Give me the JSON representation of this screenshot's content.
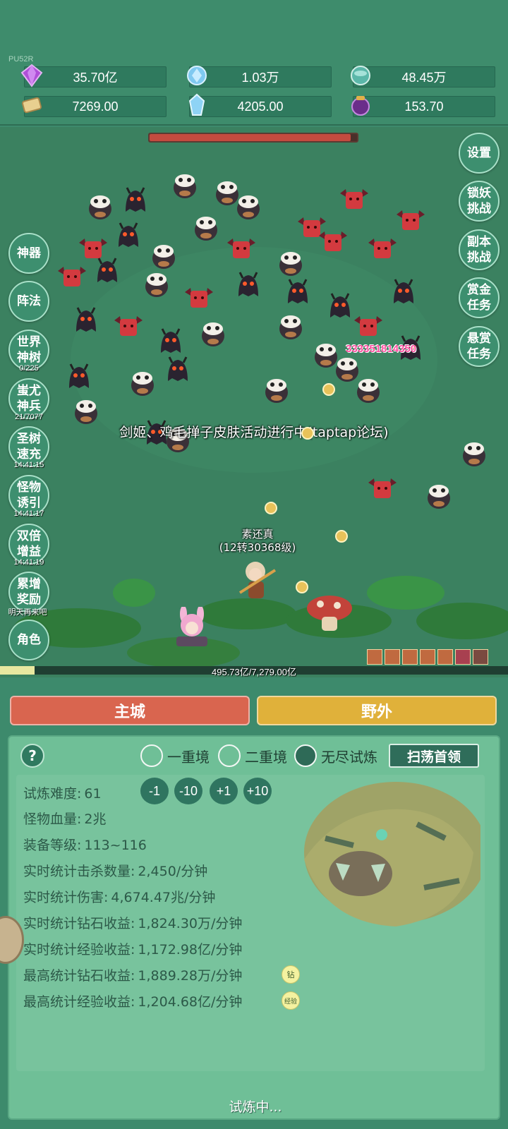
{
  "header": {
    "build_tag": "PU52R",
    "resources": [
      {
        "icon": "purple-gem-icon",
        "value": "35.70亿"
      },
      {
        "icon": "blue-crystal-icon",
        "value": "1.03万"
      },
      {
        "icon": "green-orb-icon",
        "value": "48.45万"
      },
      {
        "icon": "scroll-icon",
        "value": "7269.00"
      },
      {
        "icon": "ice-shard-icon",
        "value": "4205.00"
      },
      {
        "icon": "dark-pot-icon",
        "value": "153.70"
      }
    ]
  },
  "field": {
    "boss_hp_fraction": 0.97,
    "damage_number": "333351814350",
    "announcement": "剑姬、鸡毛掸子皮肤活动进行中(taptap论坛)",
    "hero_name": "素还真",
    "hero_level": "(12转30368级)",
    "exp_fraction": 0.068,
    "exp_text": "495.73亿/7,279.00亿"
  },
  "left_buttons": [
    {
      "label": "神器",
      "sub": ""
    },
    {
      "label": "阵法",
      "sub": ""
    },
    {
      "label": "世界\n神树",
      "sub": "0/225"
    },
    {
      "label": "蚩尤\n神兵",
      "sub": "21/7077"
    },
    {
      "label": "圣树\n速充",
      "sub": "14:41:15"
    },
    {
      "label": "怪物\n诱引",
      "sub": "14:41:17"
    },
    {
      "label": "双倍\n增益",
      "sub": "14:41:19"
    },
    {
      "label": "累增\n奖励",
      "sub": "明天再来吧"
    },
    {
      "label": "角色",
      "sub": ""
    }
  ],
  "right_buttons": [
    {
      "label": "设置"
    },
    {
      "label": "锁妖\n挑战"
    },
    {
      "label": "副本\n挑战"
    },
    {
      "label": "赏金\n任务"
    },
    {
      "label": "悬赏\n任务"
    }
  ],
  "tabs": {
    "main_city": "主城",
    "wild": "野外"
  },
  "panel": {
    "help": "?",
    "modes": [
      "一重境",
      "二重境",
      "无尽试炼"
    ],
    "selected_mode": 2,
    "sweep_button": "扫荡首领",
    "difficulty_label": "试炼难度:",
    "difficulty_value": "61",
    "adjust_buttons": [
      "-1",
      "-10",
      "+1",
      "+10"
    ],
    "stats": [
      {
        "label": "怪物血量:",
        "value": "2兆"
      },
      {
        "label": "装备等级:",
        "value": "113~116"
      },
      {
        "label": "实时统计击杀数量:",
        "value": "2,450/分钟"
      },
      {
        "label": "实时统计伤害:",
        "value": "4,674.47兆/分钟"
      },
      {
        "label": "实时统计钻石收益:",
        "value": "1,824.30万/分钟"
      },
      {
        "label": "实时统计经验收益:",
        "value": "1,172.98亿/分钟"
      },
      {
        "label": "最高统计钻石收益:",
        "value": "1,889.28万/分钟",
        "badge": "钻"
      },
      {
        "label": "最高统计经验收益:",
        "value": "1,204.68亿/分钟",
        "badge": "经验"
      }
    ],
    "status": "试炼中..."
  },
  "colors": {
    "main_city_tab": "#d9654f",
    "wild_tab": "#e0b13a",
    "boss_bar": "#c44b3f",
    "damage_text": "#ff4fa0"
  }
}
